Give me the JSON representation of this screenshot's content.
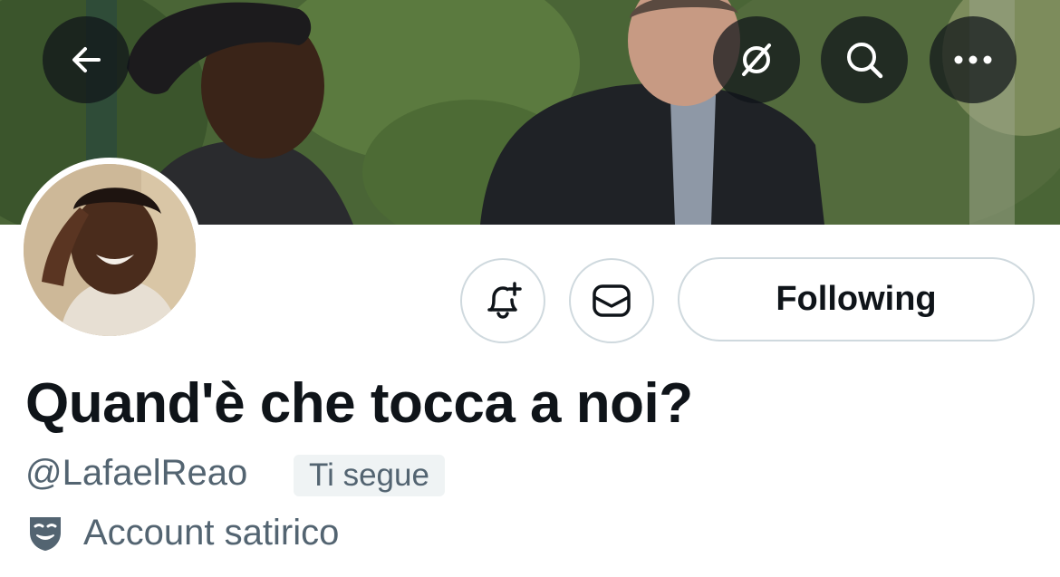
{
  "header": {
    "back_icon": "arrow-left-icon",
    "grok_icon": "slashed-circle-icon",
    "search_icon": "search-icon",
    "more_icon": "ellipsis-icon"
  },
  "profile": {
    "display_name": "Quand'è che tocca a noi?",
    "handle": "@LafaelReao",
    "follows_you_badge": "Ti segue",
    "account_label": "Account satirico",
    "account_label_icon": "theater-masks-icon"
  },
  "actions": {
    "notify_icon": "bell-plus-icon",
    "message_icon": "envelope-icon",
    "following_label": "Following"
  },
  "colors": {
    "text_primary": "#0f1419",
    "text_secondary": "#536471",
    "border": "#cfd9de",
    "badge_bg": "#eff3f4"
  }
}
